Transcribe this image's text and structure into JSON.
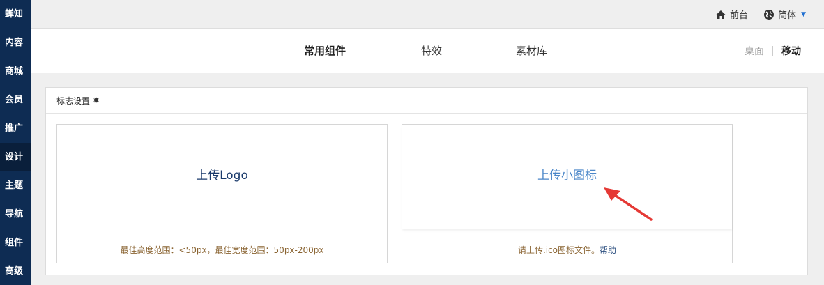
{
  "sidebar": {
    "items": [
      {
        "label": "蝉知"
      },
      {
        "label": "内容"
      },
      {
        "label": "商城"
      },
      {
        "label": "会员"
      },
      {
        "label": "推广"
      },
      {
        "label": "设计",
        "active": true
      },
      {
        "label": "主题"
      },
      {
        "label": "导航"
      },
      {
        "label": "组件"
      },
      {
        "label": "高级"
      }
    ]
  },
  "topbar": {
    "frontend_label": "前台",
    "language_label": "简体",
    "home_icon": "home-icon",
    "globe_icon": "globe-icon",
    "caret_icon": "caret-down-icon"
  },
  "nav": {
    "tabs": [
      {
        "label": "常用组件",
        "active": true
      },
      {
        "label": "特效"
      },
      {
        "label": "素材库"
      }
    ],
    "device": {
      "desktop": "桌面",
      "mobile": "移动"
    }
  },
  "panel": {
    "title": "标志设置",
    "gear_icon": "gear-icon",
    "logo_card": {
      "upload": "上传Logo",
      "hint": "最佳高度范围：<50px，最佳宽度范围：50px-200px"
    },
    "icon_card": {
      "upload": "上传小图标",
      "hint": "请上传.ico图标文件。",
      "help": "帮助"
    }
  },
  "colors": {
    "sidebar_bg": "#0e2c53",
    "accent": "#4a86c8",
    "arrow": "#e53935"
  }
}
